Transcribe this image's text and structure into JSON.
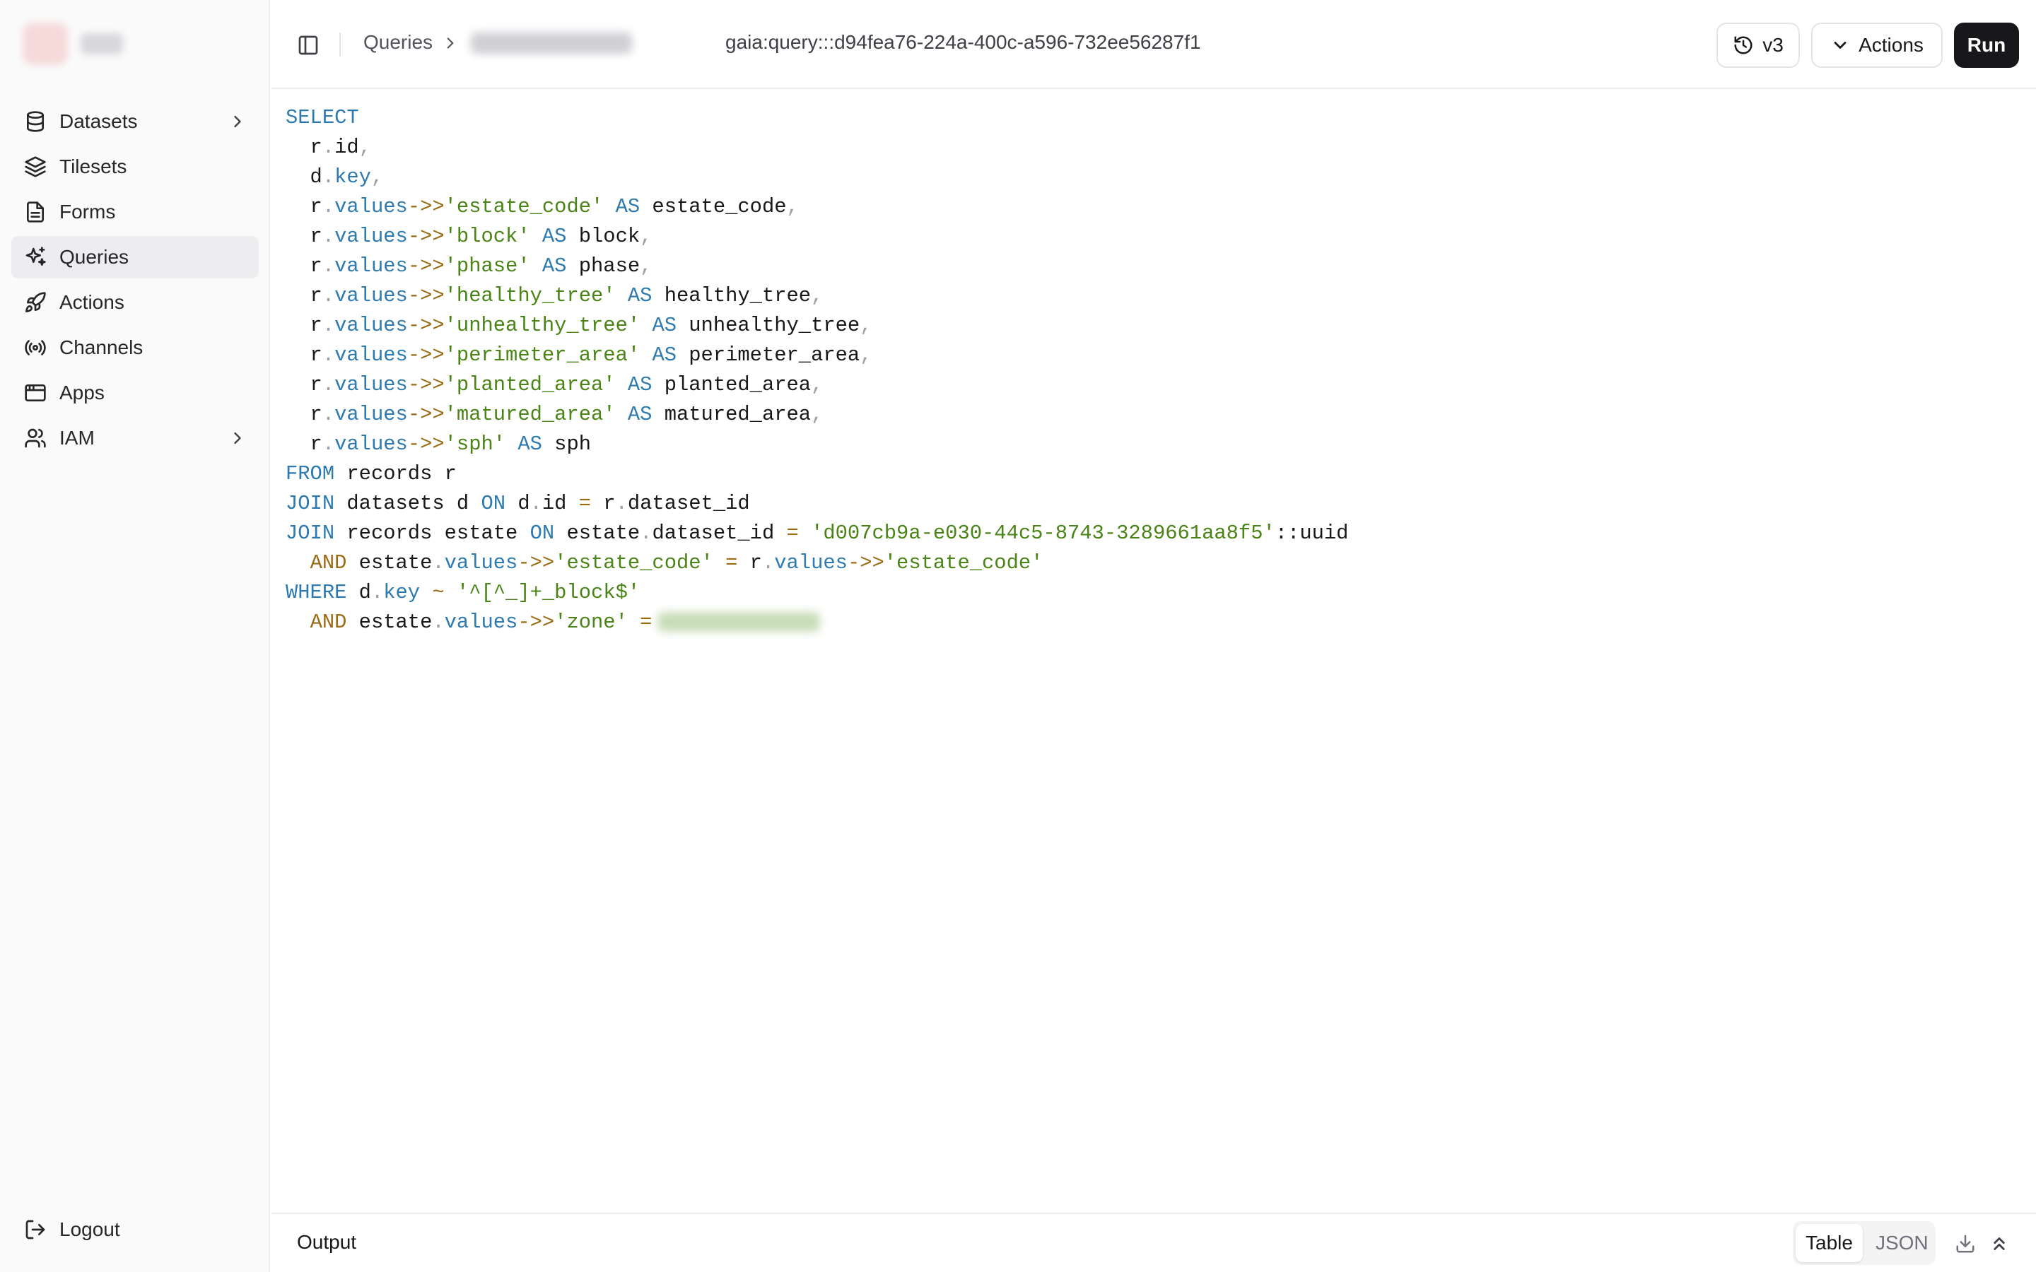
{
  "sidebar": {
    "items": [
      {
        "label": "Datasets",
        "icon": "database-icon",
        "has_chevron": true
      },
      {
        "label": "Tilesets",
        "icon": "layers-icon",
        "has_chevron": false
      },
      {
        "label": "Forms",
        "icon": "file-text-icon",
        "has_chevron": false
      },
      {
        "label": "Queries",
        "icon": "sparkles-icon",
        "has_chevron": false,
        "active": true
      },
      {
        "label": "Actions",
        "icon": "rocket-icon",
        "has_chevron": false
      },
      {
        "label": "Channels",
        "icon": "radio-icon",
        "has_chevron": false
      },
      {
        "label": "Apps",
        "icon": "app-window-icon",
        "has_chevron": false
      },
      {
        "label": "IAM",
        "icon": "users-icon",
        "has_chevron": true
      }
    ],
    "logout_label": "Logout"
  },
  "header": {
    "breadcrumb_root": "Queries",
    "query_id": "gaia:query:::d94fea76-224a-400c-a596-732ee56287f1",
    "version_label": "v3",
    "actions_label": "Actions",
    "run_label": "Run"
  },
  "editor": {
    "lines": [
      [
        [
          "kw",
          "SELECT"
        ]
      ],
      [
        [
          "tx",
          "  r"
        ],
        [
          "pu",
          "."
        ],
        [
          "tx",
          "id"
        ],
        [
          "pu",
          ","
        ]
      ],
      [
        [
          "tx",
          "  d"
        ],
        [
          "pu",
          "."
        ],
        [
          "fd",
          "key"
        ],
        [
          "pu",
          ","
        ]
      ],
      [
        [
          "tx",
          "  r"
        ],
        [
          "pu",
          "."
        ],
        [
          "fd",
          "values"
        ],
        [
          "op",
          "->>"
        ],
        [
          "st",
          "'estate_code'"
        ],
        [
          "tx",
          " "
        ],
        [
          "kw",
          "AS"
        ],
        [
          "tx",
          " estate_code"
        ],
        [
          "pu",
          ","
        ]
      ],
      [
        [
          "tx",
          "  r"
        ],
        [
          "pu",
          "."
        ],
        [
          "fd",
          "values"
        ],
        [
          "op",
          "->>"
        ],
        [
          "st",
          "'block'"
        ],
        [
          "tx",
          " "
        ],
        [
          "kw",
          "AS"
        ],
        [
          "tx",
          " block"
        ],
        [
          "pu",
          ","
        ]
      ],
      [
        [
          "tx",
          "  r"
        ],
        [
          "pu",
          "."
        ],
        [
          "fd",
          "values"
        ],
        [
          "op",
          "->>"
        ],
        [
          "st",
          "'phase'"
        ],
        [
          "tx",
          " "
        ],
        [
          "kw",
          "AS"
        ],
        [
          "tx",
          " phase"
        ],
        [
          "pu",
          ","
        ]
      ],
      [
        [
          "tx",
          "  r"
        ],
        [
          "pu",
          "."
        ],
        [
          "fd",
          "values"
        ],
        [
          "op",
          "->>"
        ],
        [
          "st",
          "'healthy_tree'"
        ],
        [
          "tx",
          " "
        ],
        [
          "kw",
          "AS"
        ],
        [
          "tx",
          " healthy_tree"
        ],
        [
          "pu",
          ","
        ]
      ],
      [
        [
          "tx",
          "  r"
        ],
        [
          "pu",
          "."
        ],
        [
          "fd",
          "values"
        ],
        [
          "op",
          "->>"
        ],
        [
          "st",
          "'unhealthy_tree'"
        ],
        [
          "tx",
          " "
        ],
        [
          "kw",
          "AS"
        ],
        [
          "tx",
          " unhealthy_tree"
        ],
        [
          "pu",
          ","
        ]
      ],
      [
        [
          "tx",
          "  r"
        ],
        [
          "pu",
          "."
        ],
        [
          "fd",
          "values"
        ],
        [
          "op",
          "->>"
        ],
        [
          "st",
          "'perimeter_area'"
        ],
        [
          "tx",
          " "
        ],
        [
          "kw",
          "AS"
        ],
        [
          "tx",
          " perimeter_area"
        ],
        [
          "pu",
          ","
        ]
      ],
      [
        [
          "tx",
          "  r"
        ],
        [
          "pu",
          "."
        ],
        [
          "fd",
          "values"
        ],
        [
          "op",
          "->>"
        ],
        [
          "st",
          "'planted_area'"
        ],
        [
          "tx",
          " "
        ],
        [
          "kw",
          "AS"
        ],
        [
          "tx",
          " planted_area"
        ],
        [
          "pu",
          ","
        ]
      ],
      [
        [
          "tx",
          "  r"
        ],
        [
          "pu",
          "."
        ],
        [
          "fd",
          "values"
        ],
        [
          "op",
          "->>"
        ],
        [
          "st",
          "'matured_area'"
        ],
        [
          "tx",
          " "
        ],
        [
          "kw",
          "AS"
        ],
        [
          "tx",
          " matured_area"
        ],
        [
          "pu",
          ","
        ]
      ],
      [
        [
          "tx",
          "  r"
        ],
        [
          "pu",
          "."
        ],
        [
          "fd",
          "values"
        ],
        [
          "op",
          "->>"
        ],
        [
          "st",
          "'sph'"
        ],
        [
          "tx",
          " "
        ],
        [
          "kw",
          "AS"
        ],
        [
          "tx",
          " sph"
        ]
      ],
      [
        [
          "kw",
          "FROM"
        ],
        [
          "tx",
          " records r"
        ]
      ],
      [
        [
          "kw",
          "JOIN"
        ],
        [
          "tx",
          " datasets d "
        ],
        [
          "kw",
          "ON"
        ],
        [
          "tx",
          " d"
        ],
        [
          "pu",
          "."
        ],
        [
          "tx",
          "id "
        ],
        [
          "op",
          "="
        ],
        [
          "tx",
          " r"
        ],
        [
          "pu",
          "."
        ],
        [
          "tx",
          "dataset_id"
        ]
      ],
      [
        [
          "kw",
          "JOIN"
        ],
        [
          "tx",
          " records estate "
        ],
        [
          "kw",
          "ON"
        ],
        [
          "tx",
          " estate"
        ],
        [
          "pu",
          "."
        ],
        [
          "tx",
          "dataset_id "
        ],
        [
          "op",
          "="
        ],
        [
          "tx",
          " "
        ],
        [
          "st",
          "'d007cb9a-e030-44c5-8743-3289661aa8f5'"
        ],
        [
          "tx",
          "::uuid"
        ]
      ],
      [
        [
          "tx",
          "  "
        ],
        [
          "op",
          "AND"
        ],
        [
          "tx",
          " estate"
        ],
        [
          "pu",
          "."
        ],
        [
          "fd",
          "values"
        ],
        [
          "op",
          "->>"
        ],
        [
          "st",
          "'estate_code'"
        ],
        [
          "tx",
          " "
        ],
        [
          "op",
          "="
        ],
        [
          "tx",
          " r"
        ],
        [
          "pu",
          "."
        ],
        [
          "fd",
          "values"
        ],
        [
          "op",
          "->>"
        ],
        [
          "st",
          "'estate_code'"
        ]
      ],
      [
        [
          "kw",
          "WHERE"
        ],
        [
          "tx",
          " d"
        ],
        [
          "pu",
          "."
        ],
        [
          "fd",
          "key"
        ],
        [
          "tx",
          " "
        ],
        [
          "op",
          "~"
        ],
        [
          "tx",
          " "
        ],
        [
          "st",
          "'^[^_]+_block$'"
        ]
      ],
      [
        [
          "tx",
          "  "
        ],
        [
          "op",
          "AND"
        ],
        [
          "tx",
          " estate"
        ],
        [
          "pu",
          "."
        ],
        [
          "fd",
          "values"
        ],
        [
          "op",
          "->>"
        ],
        [
          "st",
          "'zone'"
        ],
        [
          "tx",
          " "
        ],
        [
          "op",
          "="
        ],
        [
          "blur",
          ""
        ]
      ]
    ]
  },
  "output": {
    "title": "Output",
    "tab_table": "Table",
    "tab_json": "JSON",
    "active_tab": "Table"
  },
  "colors": {
    "keyword": "#2d7ab0",
    "string": "#4a8416",
    "operator": "#9a6b12",
    "run_button": "#18181b"
  }
}
